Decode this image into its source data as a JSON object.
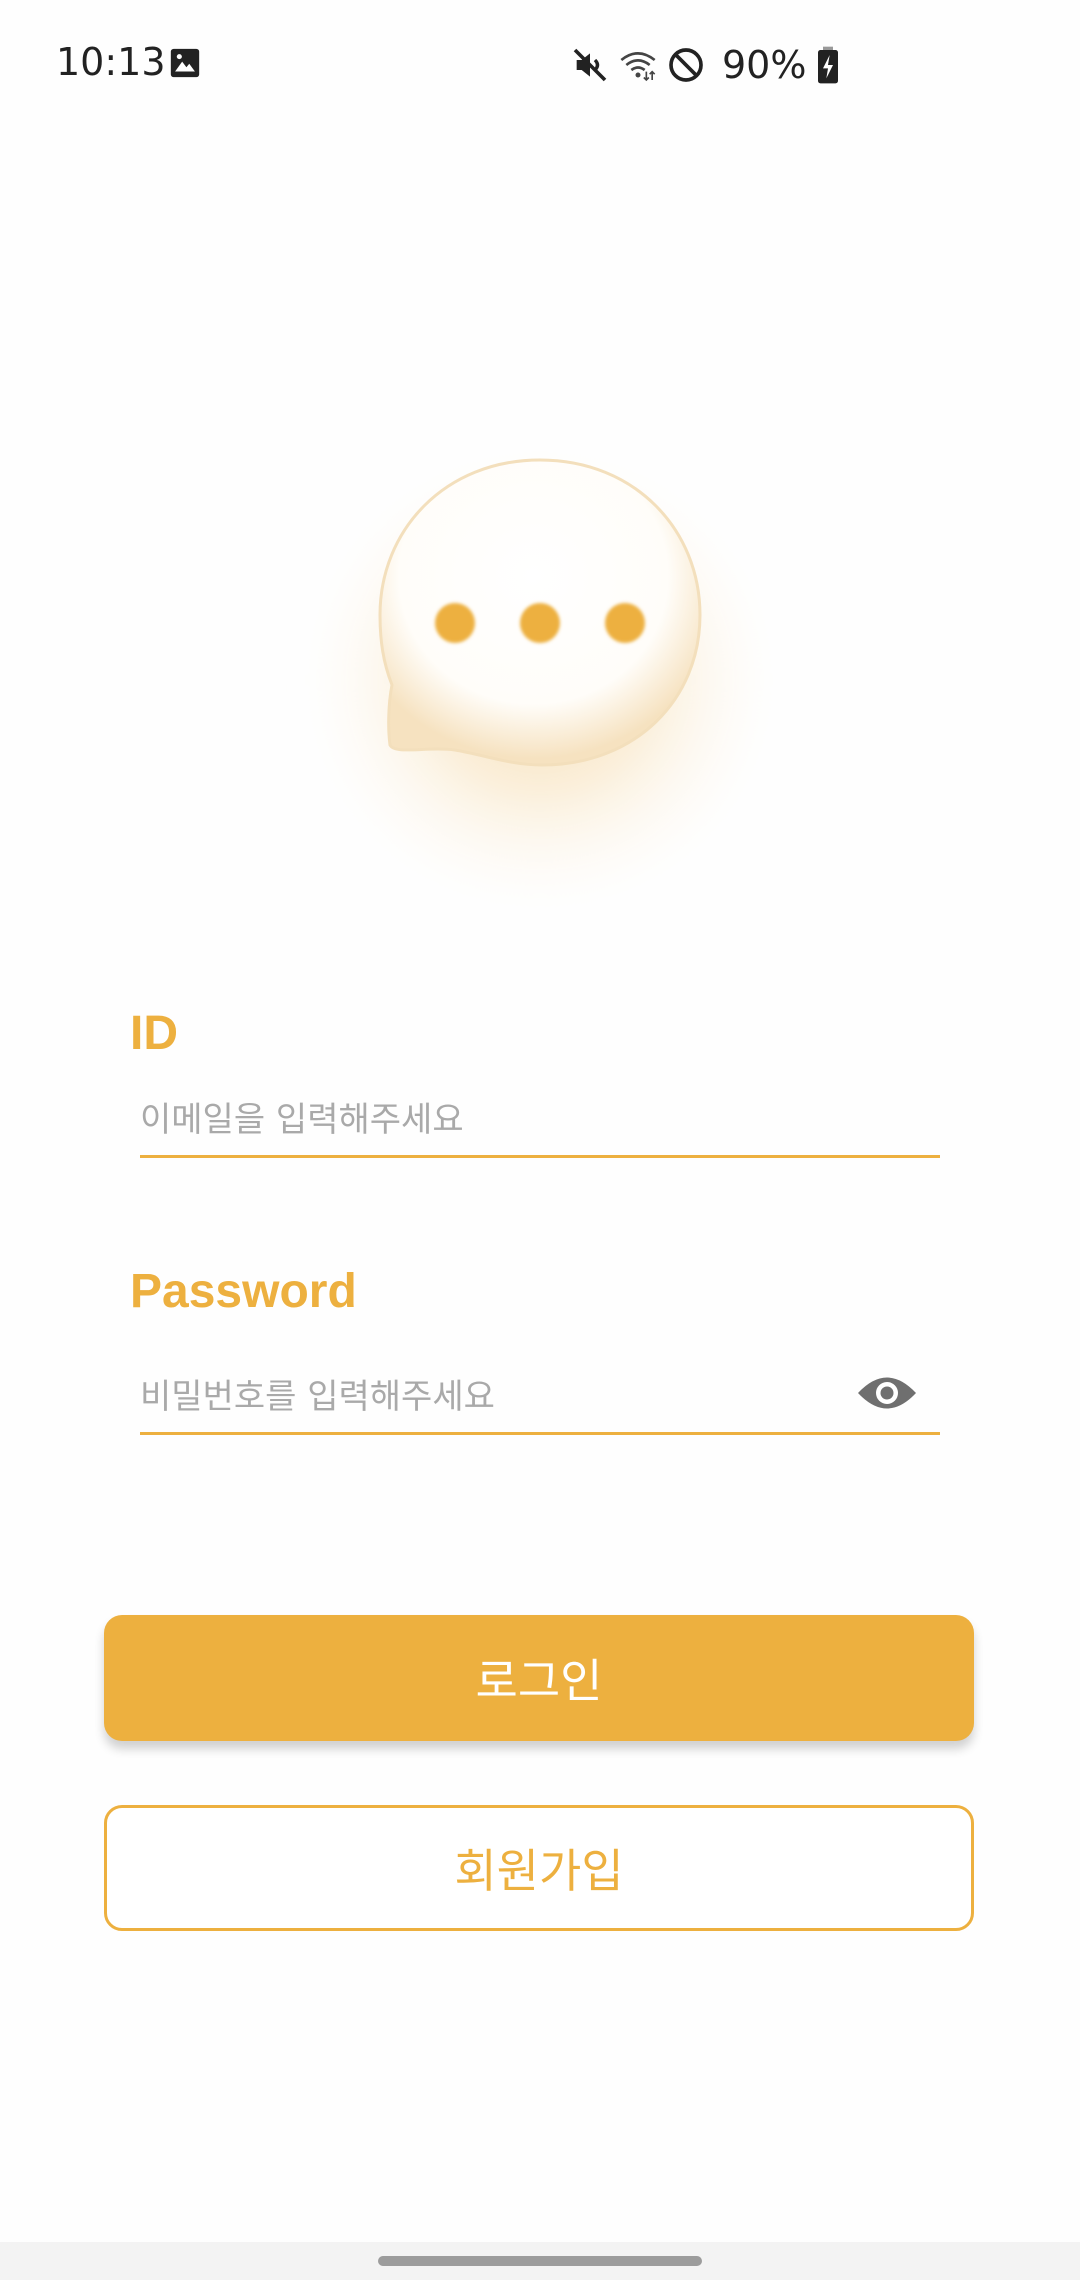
{
  "status_bar": {
    "time": "10:13",
    "battery": "90%",
    "icons": [
      "image-icon",
      "mute-icon",
      "wifi-icon",
      "do-not-disturb-icon",
      "battery-charging-icon"
    ]
  },
  "login": {
    "id_label": "ID",
    "id_placeholder": "이메일을 입력해주세요",
    "id_value": "",
    "password_label": "Password",
    "password_placeholder": "비밀번호를 입력해주세요",
    "password_value": "",
    "login_button": "로그인",
    "signup_button": "회원가입"
  },
  "colors": {
    "accent": "#edb03f",
    "placeholder": "#a9a9a9",
    "background": "#ffffff"
  }
}
